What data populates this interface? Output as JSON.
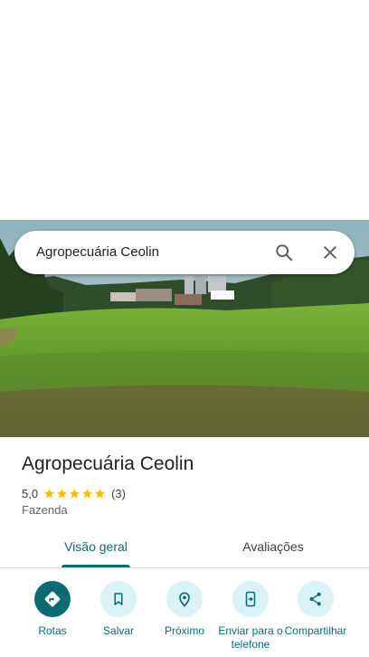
{
  "search": {
    "query": "Agropecuária Ceolin",
    "icons": {
      "search": "search-icon",
      "close": "close-icon"
    }
  },
  "place": {
    "name": "Agropecuária Ceolin",
    "rating": "5,0",
    "stars": 5,
    "review_count": "(3)",
    "category": "Fazenda"
  },
  "tabs": [
    {
      "label": "Visão geral",
      "selected": true
    },
    {
      "label": "Avaliações",
      "selected": false
    }
  ],
  "actions": [
    {
      "label": "Rotas",
      "icon": "directions-icon",
      "primary": true
    },
    {
      "label": "Salvar",
      "icon": "bookmark-icon",
      "primary": false
    },
    {
      "label": "Próximo",
      "icon": "nearby-icon",
      "primary": false
    },
    {
      "label": "Enviar para o telefone",
      "icon": "send-to-phone-icon",
      "primary": false
    },
    {
      "label": "Compartilhar",
      "icon": "share-icon",
      "primary": false
    }
  ],
  "colors": {
    "accent": "#0b6b73",
    "action_bg": "#d9f3f7",
    "star": "#fbbc04"
  }
}
